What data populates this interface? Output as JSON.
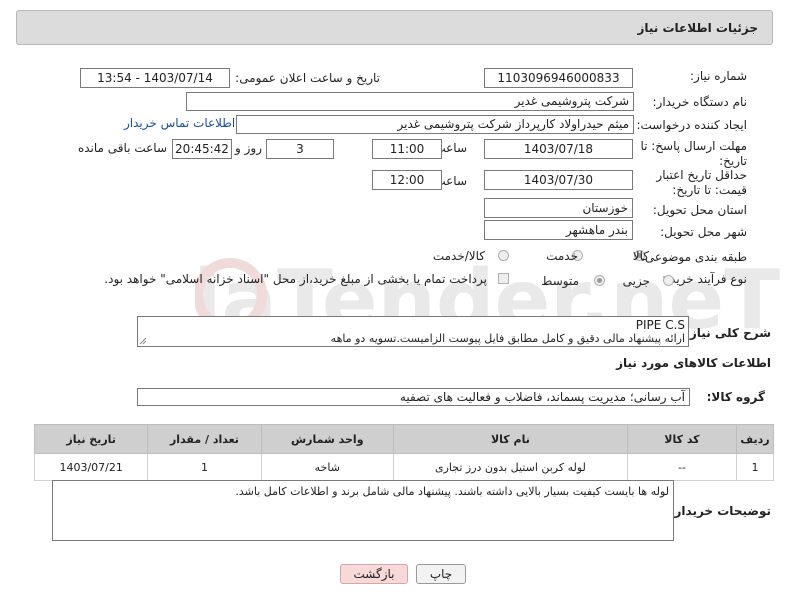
{
  "header": {
    "title": "جزئیات اطلاعات نیاز"
  },
  "fields": {
    "need_number_label": "شماره نیاز:",
    "need_number": "1103096946000833",
    "announce_label": "تاریخ و ساعت اعلان عمومی:",
    "announce_value": "1403/07/14 - 13:54",
    "buyer_org_label": "نام دستگاه خریدار:",
    "buyer_org": "شرکت پتروشیمی غدیر",
    "creator_label": "ایجاد کننده درخواست:",
    "creator": "میثم حیدراولاد کارپرداز شرکت پتروشیمی غدیر",
    "contact_link": "اطلاعات تماس خریدار",
    "reply_deadline_label": "مهلت ارسال پاسخ: تا تاریخ:",
    "reply_date": "1403/07/18",
    "time_label": "ساعت",
    "reply_time": "11:00",
    "days_count": "3",
    "days_and_label": "روز و",
    "remaining_time": "20:45:42",
    "remaining_label": "ساعت باقی مانده",
    "price_validity_label": "حداقل تاریخ اعتبار قیمت: تا تاریخ:",
    "price_date": "1403/07/30",
    "price_time": "12:00",
    "province_label": "استان محل تحویل:",
    "province": "خوزستان",
    "city_label": "شهر محل تحویل:",
    "city": "بندر ماهشهر",
    "category_label": "طبقه بندی موضوعی:",
    "category_options": [
      "کالا",
      "خدمت",
      "کالا/خدمت"
    ],
    "process_label": "نوع فرآیند خرید :",
    "process_options": [
      "جزیی",
      "متوسط"
    ],
    "process_note": "پرداخت تمام یا بخشی از مبلغ خرید،از محل \"اسناد خزانه اسلامی\" خواهد بود."
  },
  "description": {
    "label": "شرح کلی نیاز:",
    "line1": "PIPE C.S",
    "line2": "ارائه پیشنهاد مالی دقیق و کامل مطابق فایل پیوست الزامیست.تسویه دو ماهه"
  },
  "goods": {
    "section_title": "اطلاعات کالاهای مورد نیاز",
    "group_label": "گروه کالا:",
    "group_value": "آب رسانی؛ مدیریت پسماند، فاضلاب و فعالیت های تصفیه",
    "columns": [
      "ردیف",
      "کد کالا",
      "نام کالا",
      "واحد شمارش",
      "تعداد / مقدار",
      "تاریخ نیاز"
    ],
    "rows": [
      [
        "1",
        "--",
        "لوله کربن استیل بدون درز تجاری",
        "شاخه",
        "1",
        "1403/07/21"
      ]
    ]
  },
  "buyer_notes": {
    "label": "توضیحات خریدار:",
    "text": "لوله ها بایست کیفیت بسیار بالایی داشته باشند. پیشنهاد مالی شامل برند و اطلاعات کامل باشد."
  },
  "buttons": {
    "print": "چاپ",
    "back": "بازگشت"
  },
  "watermark": {
    "text": "AriaTender.neT"
  },
  "colors": {
    "link": "#1a4fa0",
    "header_bg": "#dcdcdc",
    "table_header": "#cfcfcf",
    "back_btn": "#f7d9d9"
  }
}
